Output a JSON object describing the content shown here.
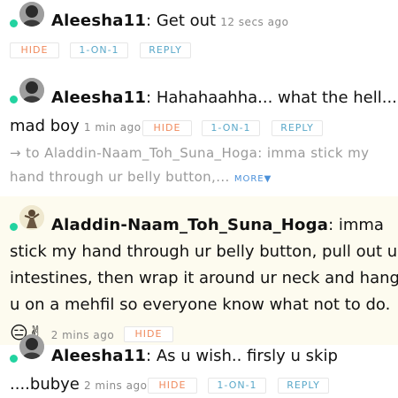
{
  "messages": [
    {
      "user": "Aleesha11",
      "text": ": Get out",
      "time": "12 secs ago",
      "buttons": [
        "HIDE",
        "1-ON-1",
        "REPLY"
      ]
    },
    {
      "user": "Aleesha11",
      "text_line1": ": Hahahaahha... what the hell...",
      "text_line2": "mad boy",
      "time": "1 min ago",
      "buttons": [
        "HIDE",
        "1-ON-1",
        "REPLY"
      ],
      "quote_line1": "→ to Aladdin-Naam_Toh_Suna_Hoga: imma stick my",
      "quote_line2": "hand through ur belly button,...",
      "more": "MORE▼"
    },
    {
      "user": "Aladdin-Naam_Toh_Suna_Hoga",
      "text_line1": ": imma",
      "text_line2": "stick my hand through ur belly button, pull out ur",
      "text_line3": "intestines, then wrap it around ur neck and hang",
      "text_line4": "u on a mehfil so everyone know what not to do.",
      "emojis": "😑✌",
      "time": "2 mins ago",
      "buttons": [
        "HIDE"
      ]
    },
    {
      "user": "Aleesha11",
      "text_line1": ": As u wish.. firsly u skip",
      "text_line2": "....bubye",
      "time": "2 mins ago",
      "buttons": [
        "HIDE",
        "1-ON-1",
        "REPLY"
      ]
    }
  ]
}
